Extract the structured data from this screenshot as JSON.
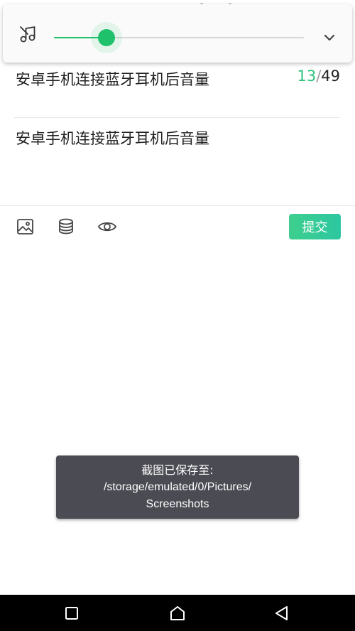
{
  "volume": {
    "level": 0.21,
    "accent": "#1fc16b",
    "icons": {
      "left": "music-note-icon",
      "right": "chevron-down-icon"
    }
  },
  "post": {
    "title": "安卓手机连接蓝牙耳机后音量",
    "counter_current": "13",
    "counter_separator": "/",
    "counter_max": "49",
    "body": "安卓手机连接蓝牙耳机后音量"
  },
  "toolbar": {
    "icons": [
      "image-icon",
      "database-icon",
      "eye-icon"
    ],
    "submit_label": "提交",
    "submit_color": "#3ecf8e"
  },
  "toast": {
    "line1": "截图已保存至:",
    "line2": "/storage/emulated/0/Pictures/",
    "line3": "Screenshots"
  },
  "navbar": {
    "icons": [
      "recent-apps-icon",
      "home-icon",
      "back-icon"
    ]
  }
}
